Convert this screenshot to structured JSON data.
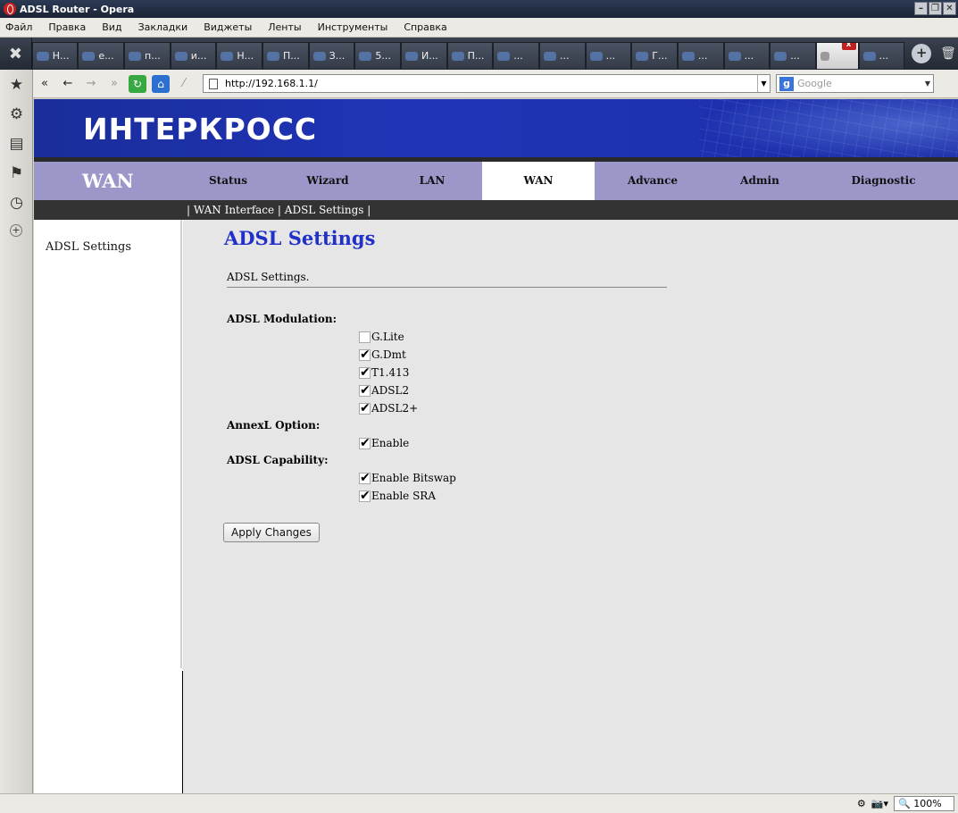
{
  "window": {
    "title": "ADSL Router - Opera"
  },
  "menu": [
    "Файл",
    "Правка",
    "Вид",
    "Закладки",
    "Виджеты",
    "Ленты",
    "Инструменты",
    "Справка"
  ],
  "tabs": [
    "Н...",
    "е...",
    "п...",
    "и...",
    "Н...",
    "П...",
    "З...",
    "5...",
    "И...",
    "П...",
    "...",
    "...",
    "...",
    "Г...",
    "...",
    "...",
    "...",
    "",
    "..."
  ],
  "active_tab_index": 17,
  "address": {
    "url": "http://192.168.1.1/",
    "search_placeholder": "Google"
  },
  "router": {
    "logo": "ИНТЕРКРОСС",
    "section": "WAN",
    "nav": [
      "Status",
      "Wizard",
      "LAN",
      "WAN",
      "Advance",
      "Admin",
      "Diagnostic"
    ],
    "active_nav": "WAN",
    "subnav": "| WAN Interface | ADSL Settings |",
    "left_nav": "ADSL Settings"
  },
  "form": {
    "title": "ADSL Settings",
    "description": "ADSL Settings.",
    "modulation_label": "ADSL Modulation:",
    "modulation": [
      {
        "label": "G.Lite",
        "checked": false
      },
      {
        "label": "G.Dmt",
        "checked": true
      },
      {
        "label": "T1.413",
        "checked": true
      },
      {
        "label": "ADSL2",
        "checked": true
      },
      {
        "label": "ADSL2+",
        "checked": true
      }
    ],
    "annexl_label": "AnnexL Option:",
    "annexl": [
      {
        "label": "Enable",
        "checked": true
      }
    ],
    "capability_label": "ADSL Capability:",
    "capability": [
      {
        "label": "Enable Bitswap",
        "checked": true
      },
      {
        "label": "Enable SRA",
        "checked": true
      }
    ],
    "apply_button": "Apply Changes"
  },
  "status": {
    "zoom": "100%"
  }
}
